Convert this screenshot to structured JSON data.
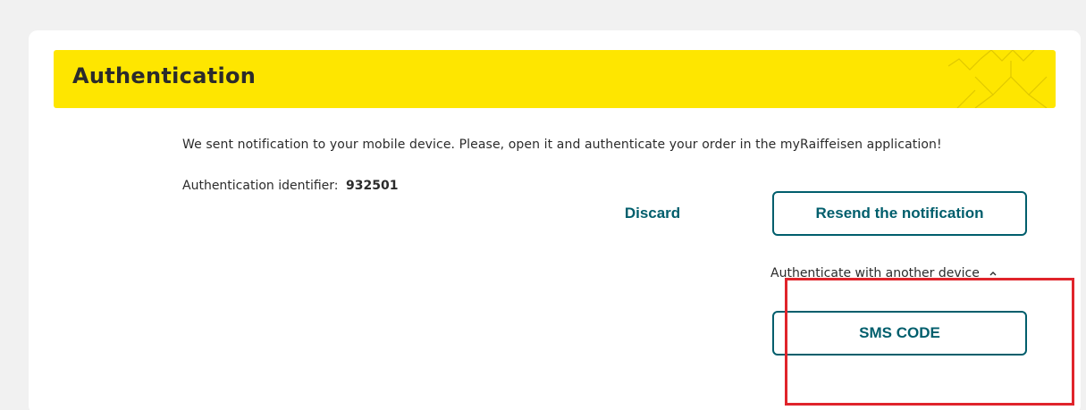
{
  "header": {
    "title": "Authentication"
  },
  "body": {
    "message": "We sent notification to your mobile device. Please, open it and authenticate your order in the myRaiffeisen application!",
    "identifier_label": "Authentication identifier:",
    "identifier_value": "932501"
  },
  "actions": {
    "discard_label": "Discard",
    "resend_label": "Resend the notification"
  },
  "another_device": {
    "toggle_label": "Authenticate with another device",
    "toggle_icon": "chevron-up-icon",
    "sms_label": "SMS CODE"
  },
  "colors": {
    "header_yellow": "#fee600",
    "accent_teal": "#005e6c",
    "highlight_red": "#e0242b",
    "background": "#f1f1f1"
  }
}
